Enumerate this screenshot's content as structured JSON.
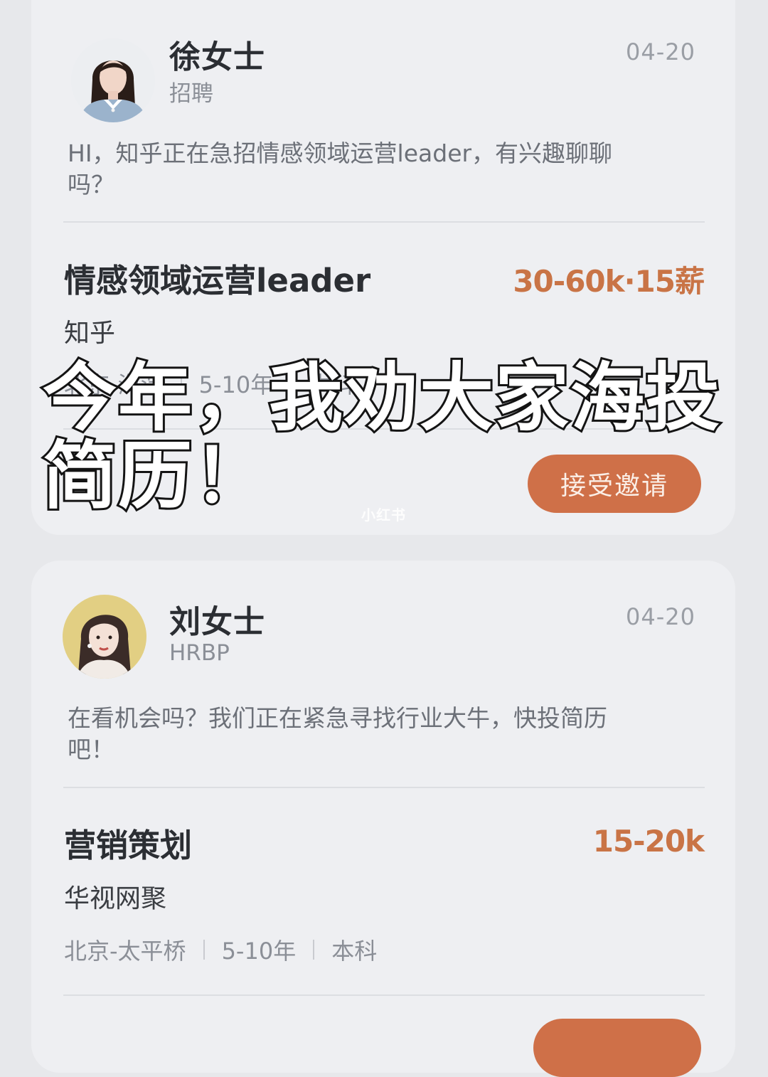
{
  "cards": [
    {
      "name": "徐女士",
      "role": "招聘",
      "date": "04-20",
      "message": "HI，知乎正在急招情感领域运营leader，有兴趣聊聊吗？",
      "job_title": "情感领域运营leader",
      "salary": "30-60k·15薪",
      "company": "知乎",
      "meta": [
        "北京-海淀",
        "5-10年",
        "本科"
      ],
      "button": "接受邀请",
      "avatar_icon": "woman-portrait-photo"
    },
    {
      "name": "刘女士",
      "role": "HRBP",
      "date": "04-20",
      "message": "在看机会吗？我们正在紧急寻找行业大牛，快投简历吧！",
      "job_title": "营销策划",
      "salary": "15-20k",
      "company": "华视网聚",
      "meta": [
        "北京-太平桥",
        "5-10年",
        "本科"
      ],
      "avatar_icon": "woman-illustration-avatar"
    }
  ],
  "overlay": {
    "line1": "今年，我劝大家海投",
    "line2": "简历！"
  },
  "watermark": "小红书",
  "colors": {
    "accent": "#cf7048",
    "salary": "#c97446",
    "background": "#e7e8eb",
    "card": "#eeeff2"
  }
}
